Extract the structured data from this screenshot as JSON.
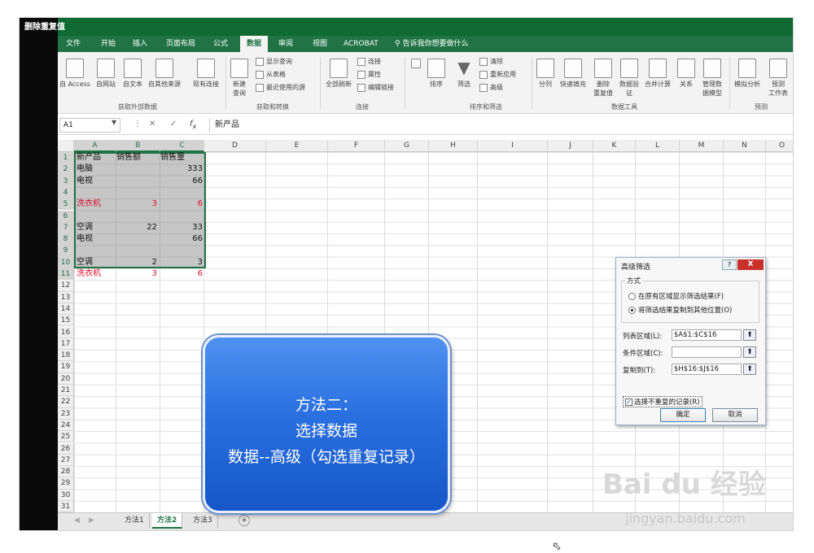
{
  "window": {
    "title": "删除重复值"
  },
  "menu": {
    "tabs": [
      {
        "label": "文件"
      },
      {
        "label": "开始"
      },
      {
        "label": "插入"
      },
      {
        "label": "页面布局"
      },
      {
        "label": "公式"
      },
      {
        "label": "数据",
        "active": true
      },
      {
        "label": "审阅"
      },
      {
        "label": "视图"
      },
      {
        "label": "ACROBAT"
      },
      {
        "label": "告诉我你想要做什么"
      }
    ]
  },
  "ribbon": {
    "groups": {
      "external": {
        "label": "获取外部数据",
        "buttons": [
          "自 Access",
          "自网站",
          "自文本",
          "自其他来源",
          "现有连接"
        ]
      },
      "transform": {
        "label": "获取和转换",
        "big": "新建\n查询",
        "small": [
          "显示查询",
          "从表格",
          "最近使用的源"
        ]
      },
      "connections": {
        "label": "连接",
        "big": "全部刷新",
        "small": [
          "连接",
          "属性",
          "编辑链接"
        ]
      },
      "sort": {
        "label": "排序和筛选",
        "buttons": [
          "排序",
          "筛选"
        ],
        "small": [
          "清除",
          "重新应用",
          "高级"
        ]
      },
      "tools": {
        "label": "数据工具",
        "buttons": [
          "分列",
          "快速填充",
          "删除\n重复值",
          "数据验\n证",
          "合并计算",
          "关系",
          "管理数\n据模型"
        ]
      },
      "forecast": {
        "label": "预测",
        "buttons": [
          "模拟分析",
          "预测\n工作表"
        ]
      }
    }
  },
  "formula_bar": {
    "name_box": "A1",
    "content": "新产品"
  },
  "grid": {
    "columns": [
      "A",
      "B",
      "C",
      "D",
      "E",
      "F",
      "G",
      "H",
      "I",
      "J",
      "K",
      "L",
      "M",
      "N",
      "O"
    ],
    "rows": [
      "1",
      "2",
      "3",
      "4",
      "5",
      "6",
      "7",
      "8",
      "9",
      "10",
      "11",
      "12",
      "13",
      "14",
      "15",
      "16",
      "17",
      "18",
      "19",
      "20",
      "21",
      "22",
      "23",
      "24",
      "25",
      "26",
      "27",
      "28",
      "29",
      "30",
      "31"
    ],
    "headers": {
      "a1": "新产品",
      "b1": "销售额",
      "c1": "销售量"
    },
    "data": [
      {
        "row": 2,
        "a": "电脑",
        "b": "",
        "c": "333",
        "red": false
      },
      {
        "row": 3,
        "a": "电视",
        "b": "",
        "c": "66",
        "red": false
      },
      {
        "row": 5,
        "a": "洗衣机",
        "b": "3",
        "c": "6",
        "red": true
      },
      {
        "row": 7,
        "a": "空调",
        "b": "22",
        "c": "33",
        "red": false
      },
      {
        "row": 8,
        "a": "电视",
        "b": "",
        "c": "66",
        "red": false
      },
      {
        "row": 10,
        "a": "空调",
        "b": "2",
        "c": "3",
        "red": false
      },
      {
        "row": 11,
        "a": "洗衣机",
        "b": "3",
        "c": "6",
        "red": true
      }
    ]
  },
  "sheets": [
    {
      "label": "方法1"
    },
    {
      "label": "方法2",
      "active": true
    },
    {
      "label": "方法3"
    }
  ],
  "callout": {
    "line1": "方法二：",
    "line2": "选择数据",
    "line3": "数据--高级（勾选重复记录）"
  },
  "dialog": {
    "title": "高级筛选",
    "method_label": "方式",
    "radio1": "在原有区域显示筛选结果(F)",
    "radio2": "将筛选结果复制到其他位置(O)",
    "list_range_label": "列表区域(L):",
    "list_range_value": "$A$1:$C$16",
    "criteria_label": "条件区域(C):",
    "criteria_value": "",
    "copy_to_label": "复制到(T):",
    "copy_to_value": "$H$16:$J$16",
    "unique_label": "选择不重复的记录(R)",
    "ok_label": "确定",
    "cancel_label": "取消",
    "help_label": "?",
    "close_label": "X"
  },
  "watermark": {
    "main": "Bai du 经验",
    "sub": "jingyan.baidu.com"
  },
  "icons": {
    "insert_function": "fx-icon",
    "cancel_edit": "cross-icon",
    "confirm_edit": "check-icon",
    "range_picker": "collapse-dialog-icon",
    "add_sheet": "plus-icon"
  }
}
